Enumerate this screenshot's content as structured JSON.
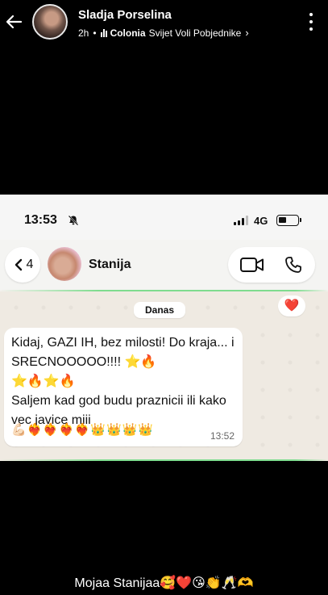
{
  "story": {
    "user_name": "Sladja Porselina",
    "time_ago": "2h",
    "dot": "•",
    "music_artist": "Colonia",
    "music_title": "Svijet Voli Pobjednike",
    "chevron": "›",
    "caption": "Mojaa Stanijaa🥰❤️😘👏🥂🫶"
  },
  "embedded_screenshot": {
    "status_bar": {
      "time": "13:53",
      "network": "4G"
    },
    "chat_header": {
      "back_count": "4",
      "contact_name": "Stanija"
    },
    "chat": {
      "date_chip": "Danas",
      "reaction": "❤️",
      "message_text": "Kidaj, GAZI IH, bez milosti! Do kraja... i SRECNOOOOO!!!! ⭐🔥\n⭐🔥⭐🔥\nSaljem kad god budu praznicii ili kako vec javice miii",
      "message_emoji": "💪🏻❤️‍🔥❤️‍🔥❤️‍🔥❤️‍🔥👑👑👑👑",
      "message_time": "13:52"
    }
  },
  "colors": {
    "story_background": "#000000",
    "chat_background": "#efeae2",
    "accent_green": "#7fdc8f",
    "heart_red": "#e0242c"
  },
  "icons": [
    "back-arrow-icon",
    "more-vert-icon",
    "music-bars-icon",
    "bell-slash-icon",
    "signal-icon",
    "battery-icon",
    "chevron-left-icon",
    "video-call-icon",
    "phone-icon",
    "heart-icon"
  ]
}
